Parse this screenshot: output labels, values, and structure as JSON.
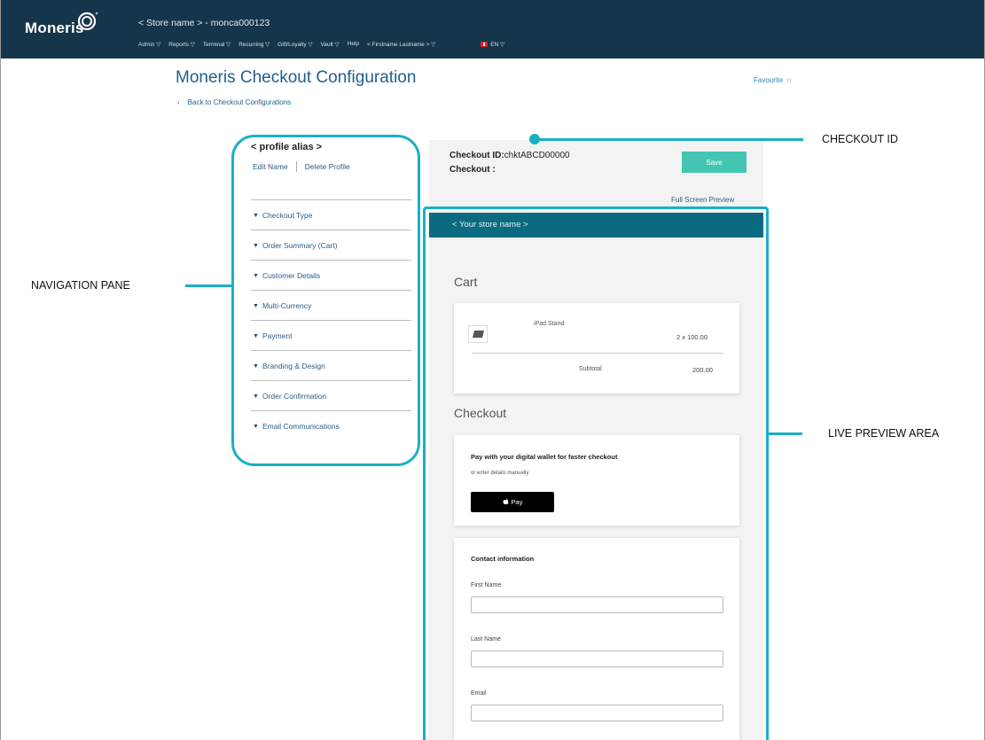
{
  "topbar": {
    "logo_text": "Moneris",
    "store_line": "< Store name > - monca000123",
    "menu": [
      "Admin ▽",
      "Reports ▽",
      "Terminal ▽",
      "Recurring ▽",
      "Gift/Loyalty ▽",
      "Vault ▽",
      "Help",
      "< Firstname Lastname > ▽"
    ],
    "language": "EN ▽"
  },
  "header": {
    "title": "Moneris Checkout Configuration",
    "back_label": "Back to Checkout Configurations",
    "back_glyph": "‹",
    "favourite_label": "Favourite",
    "favourite_glyph": "☆"
  },
  "nav": {
    "alias": "< profile alias >",
    "edit_name": "Edit Name",
    "delete_profile": "Delete Profile",
    "items": [
      "Checkout Type",
      "Order Summary (Cart)",
      "Customer Details",
      "Multi-Currency",
      "Payment",
      "Branding & Design",
      "Order Confirmation",
      "Email Communications"
    ]
  },
  "checkout": {
    "id_label": "Checkout ID:",
    "id_value": "chktABCD00000",
    "checkout_label": "Checkout :",
    "save_label": "Save",
    "full_screen_preview": "Full Screen Preview"
  },
  "preview": {
    "store_name": "< Your store name >",
    "cart_heading": "Cart",
    "cart_item_name": "iPad Stand",
    "cart_item_qty": "2 x 100.00",
    "subtotal_label": "Subtotal",
    "subtotal_value": "200.00",
    "checkout_heading": "Checkout",
    "wallet_heading": "Pay with your digital wallet for faster checkout",
    "wallet_sub": "or enter details manually",
    "apple_pay_label": "Pay",
    "contact_heading": "Contact information",
    "fields": [
      "First Name",
      "Last Name",
      "Email"
    ]
  },
  "callouts": {
    "checkout_id": "CHECKOUT ID",
    "navigation_pane": "NAVIGATION PANE",
    "live_preview": "LIVE PREVIEW AREA"
  },
  "colors": {
    "topbar": "#15354a",
    "accent": "#1ab0c4",
    "link": "#2b5d86",
    "save_button": "#43c6b1",
    "store_banner": "#0a6b80"
  }
}
